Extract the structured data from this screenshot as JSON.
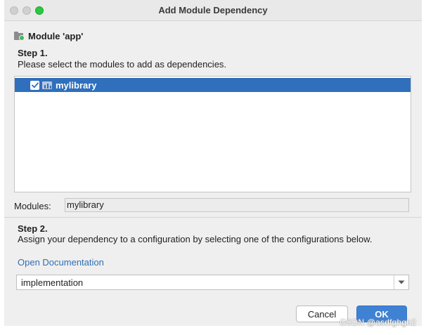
{
  "window": {
    "title": "Add Module Dependency"
  },
  "header": {
    "module_title": "Module 'app'"
  },
  "step1": {
    "label": "Step 1.",
    "description": "Please select the modules to add as dependencies.",
    "modules": [
      {
        "name": "mylibrary",
        "checked": true,
        "selected": true
      }
    ]
  },
  "modules_field": {
    "label": "Modules:",
    "value": "mylibrary"
  },
  "step2": {
    "label": "Step 2.",
    "description": "Assign your dependency to a configuration by selecting one of the configurations below.",
    "doc_link": "Open Documentation",
    "configuration": "implementation"
  },
  "buttons": {
    "cancel": "Cancel",
    "ok": "OK"
  },
  "watermark": "CSDN @asdfghgh2",
  "colors": {
    "selection": "#2f6fbc",
    "link": "#2f6fb5",
    "ok_button": "#3f82d4",
    "module_badge": "#3dbb5b"
  },
  "icons": {
    "module_header": "module-folder-icon",
    "row": "library-module-icon",
    "check": "check-icon",
    "dropdown": "chevron-down-icon"
  }
}
